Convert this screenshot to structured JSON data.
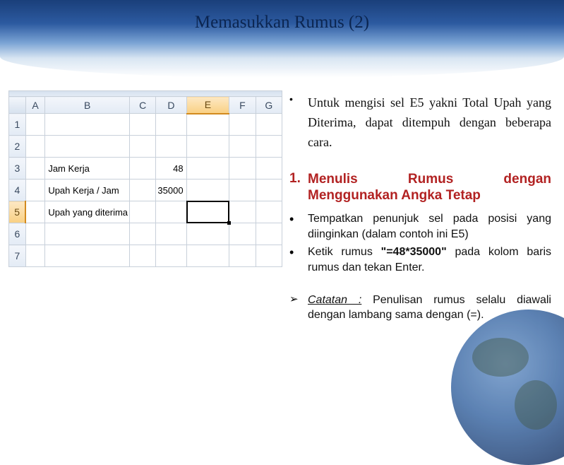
{
  "title": "Memasukkan Rumus (2)",
  "sheet": {
    "columns": [
      "A",
      "B",
      "C",
      "D",
      "E",
      "F",
      "G"
    ],
    "rows": [
      "1",
      "2",
      "3",
      "4",
      "5",
      "6",
      "7"
    ],
    "selected_col": "E",
    "selected_row": "5",
    "cells": {
      "B3": "Jam Kerja",
      "D3": "48",
      "B4": "Upah Kerja / Jam",
      "D4": "35000",
      "B5": "Upah yang diterima"
    }
  },
  "intro": "Untuk mengisi sel E5 yakni Total Upah yang Diterima, dapat ditempuh dengan beberapa cara.",
  "heading_num": "1.",
  "heading_line1": "Menulis Rumus dengan",
  "heading_line2": "Menggunakan Angka Tetap",
  "sub1": "Tempatkan penunjuk sel pada posisi yang diinginkan (dalam contoh ini E5)",
  "sub2_a": "Ketik rumus ",
  "sub2_b": "\"=48*35000\"",
  "sub2_c": " pada kolom baris rumus dan tekan Enter.",
  "note_label": "Catatan :",
  "note_text": " Penulisan rumus selalu diawali dengan lambang sama dengan (=)."
}
